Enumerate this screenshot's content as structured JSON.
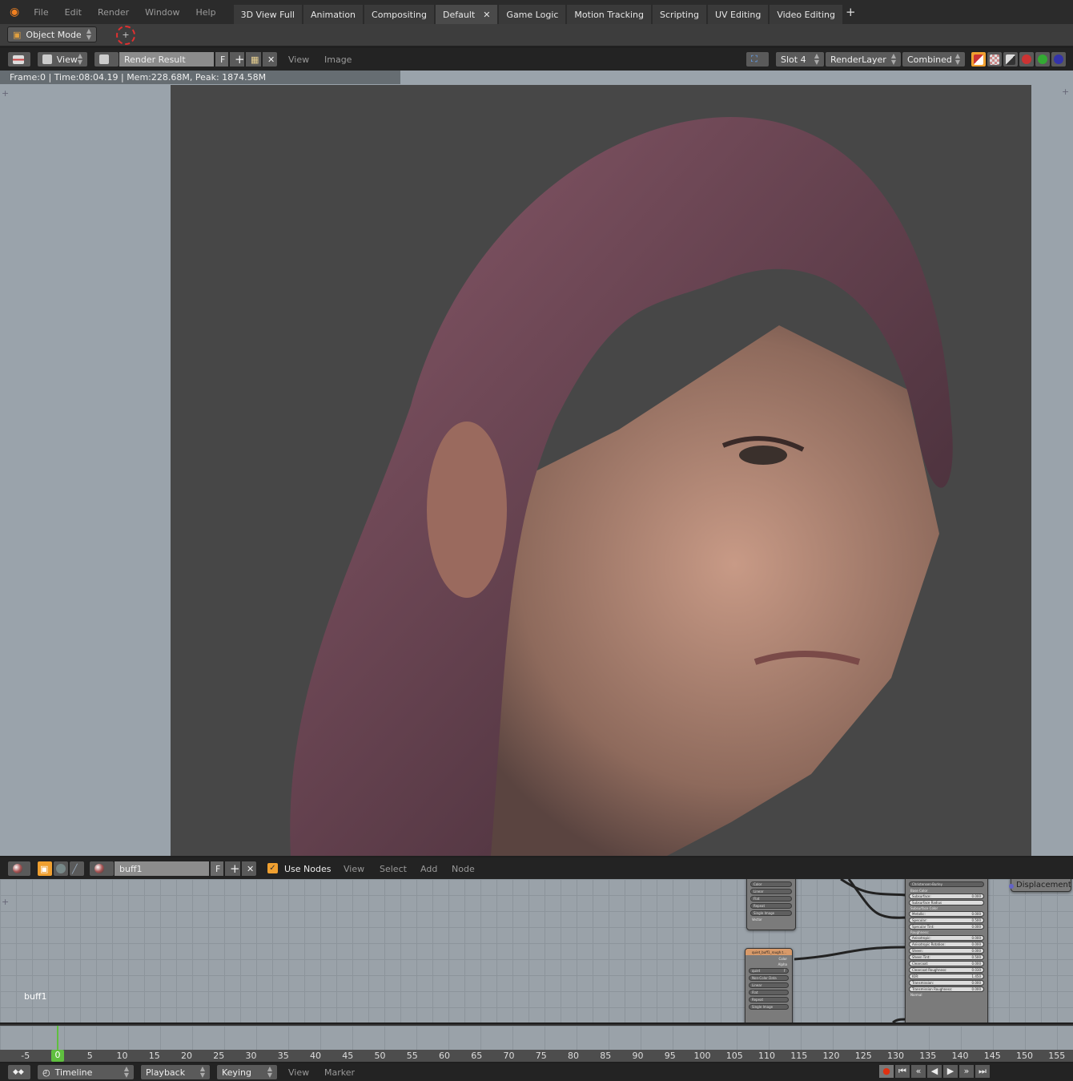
{
  "info_bar": {
    "menus": [
      "File",
      "Edit",
      "Render",
      "Window",
      "Help"
    ],
    "tabs": [
      "3D View Full",
      "Animation",
      "Compositing",
      "Default",
      "Game Logic",
      "Motion Tracking",
      "Scripting",
      "UV Editing",
      "Video Editing"
    ],
    "active_tab": "Default"
  },
  "tool_row": {
    "mode": "Object Mode"
  },
  "image_editor": {
    "view_menu": "View",
    "image_name": "Render Result",
    "fake_user": "F",
    "menus": [
      "View",
      "Image"
    ],
    "slot": "Slot 4",
    "layer": "RenderLayer",
    "pass": "Combined",
    "status": "Frame:0 | Time:08:04.19 | Mem:228.68M, Peak: 1874.58M"
  },
  "node_editor": {
    "material": "buff1",
    "fake_user": "F",
    "use_nodes_label": "Use Nodes",
    "use_nodes": true,
    "menus": [
      "View",
      "Select",
      "Add",
      "Node"
    ],
    "corner_label": "buff1",
    "tex_node_top": {
      "fields": [
        "Color",
        "Linear",
        "Flat",
        "Repeat",
        "Single Image"
      ],
      "input": "Vector"
    },
    "tex_node": {
      "title": "quiet_buff1_rough.t...",
      "outputs": [
        "Color",
        "Alpha"
      ],
      "image": "quiet",
      "fake_user": "F",
      "fields": [
        "Non-Color Data",
        "Linear",
        "Flat",
        "Repeat",
        "Single Image"
      ]
    },
    "bsdf": {
      "distribution": "Christensen-Burley",
      "rows": [
        {
          "label": "Base Color"
        },
        {
          "label": "Subsurface:",
          "value": "0.000"
        },
        {
          "label": "Subsurface Radius",
          "field": true
        },
        {
          "label": "Subsurface Color"
        },
        {
          "label": "Metallic:",
          "value": "0.000"
        },
        {
          "label": "Specular:",
          "value": "0.500"
        },
        {
          "label": "Specular Tint:",
          "value": "0.000"
        },
        {
          "label": "Roughness:"
        },
        {
          "label": "Anisotropic:",
          "value": "0.000"
        },
        {
          "label": "Anisotropic Rotation:",
          "value": "0.000"
        },
        {
          "label": "Sheen:",
          "value": "0.000"
        },
        {
          "label": "Sheen Tint:",
          "value": "0.500"
        },
        {
          "label": "Clearcoat:",
          "value": "0.000"
        },
        {
          "label": "Clearcoat Roughness:",
          "value": "0.030"
        },
        {
          "label": "IOR:",
          "value": "1.450"
        },
        {
          "label": "Transmission:",
          "value": "0.000"
        },
        {
          "label": "Transmission Roughness:",
          "value": "0.000"
        },
        {
          "label": "Normal"
        }
      ]
    },
    "output_node": {
      "label": "Displacement"
    }
  },
  "timeline": {
    "current_frame": "0",
    "ticks": [
      "-5",
      "5",
      "10",
      "15",
      "20",
      "25",
      "30",
      "35",
      "40",
      "45",
      "50",
      "55",
      "60",
      "65",
      "70",
      "75",
      "80",
      "85",
      "90",
      "95",
      "100",
      "105",
      "110",
      "115",
      "120",
      "125",
      "130",
      "135",
      "140",
      "145",
      "150",
      "155"
    ],
    "editor": "Timeline",
    "menus_dropdown": [
      "Playback",
      "Keying"
    ],
    "menus": [
      "View",
      "Marker"
    ],
    "controls": [
      "record",
      "jump-start",
      "jump-keyframe-back",
      "play-reverse",
      "play",
      "jump-keyframe-forward",
      "jump-end"
    ]
  },
  "colors": {
    "accent": "#f0a030",
    "frame_indicator": "#5fbf3f",
    "record": "#e03010"
  }
}
